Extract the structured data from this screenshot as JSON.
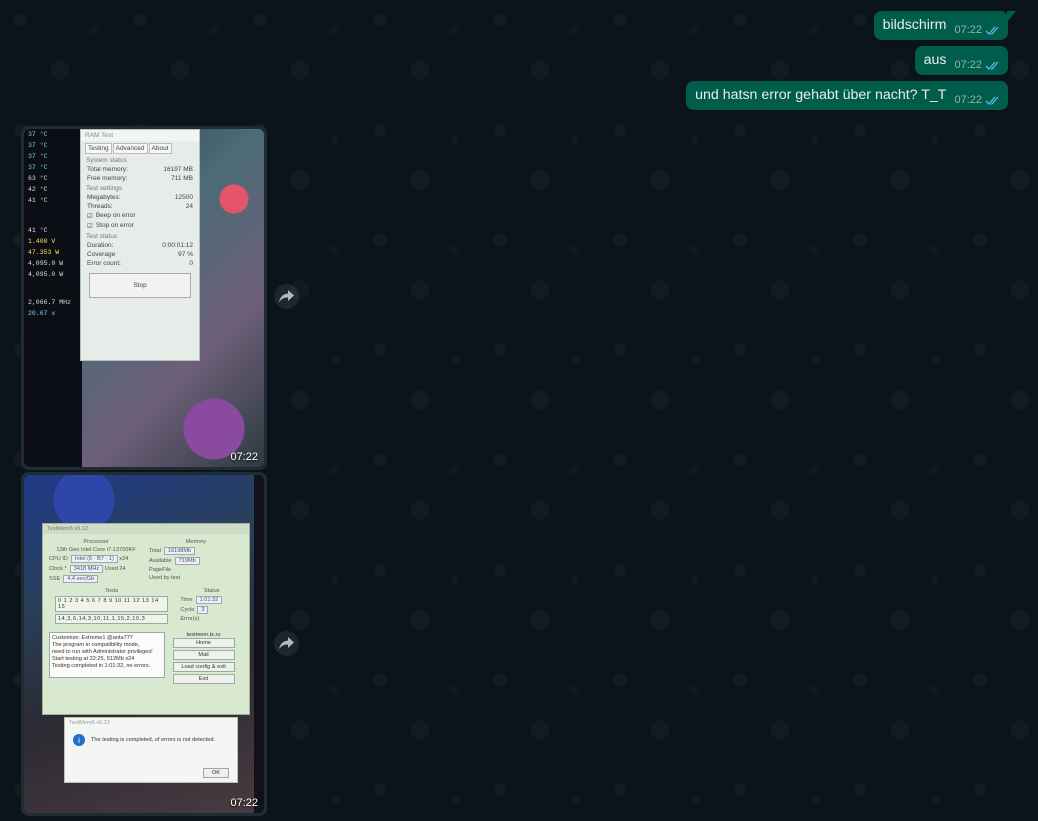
{
  "messages": [
    {
      "text": "bildschirm",
      "time": "07:22"
    },
    {
      "text": "aus",
      "time": "07:22"
    },
    {
      "text": "und hatsn error gehabt über nacht? T_T",
      "time": "07:22"
    }
  ],
  "images": [
    {
      "time": "07:22"
    },
    {
      "time": "07:22"
    }
  ],
  "photo1": {
    "temps": [
      "37 °C",
      "37 °C",
      "37 °C",
      "37 °C",
      "63 °C",
      "42 °C",
      "41 °C"
    ],
    "mid": [
      "41 °C",
      "1.400 V",
      "47.353 W",
      "4,095.0 W",
      "4,095.0 W"
    ],
    "clock": [
      "2,066.7 MHz",
      "20.67 x"
    ],
    "ram_title": "RAM Test",
    "tabs": [
      "Testing",
      "Advanced",
      "About"
    ],
    "system_status": "System status",
    "total_memory_label": "Total memory:",
    "total_memory": "16197 MB",
    "free_memory_label": "Free memory:",
    "free_memory": "711 MB",
    "test_settings": "Test settings",
    "megabytes_label": "Megabytes:",
    "megabytes": "12500",
    "threads_label": "Threads:",
    "threads": "24",
    "beep": "Beep on error",
    "stop_on_error": "Stop on error",
    "test_status": "Test status",
    "duration_label": "Duration:",
    "duration": "0:00:01:12",
    "coverage_label": "Coverage",
    "coverage": "97 %",
    "errors_label": "Error count:",
    "errors": "0",
    "stop": "Stop"
  },
  "photo2": {
    "title": "TestMem5 v0.12",
    "processor": "Processor",
    "cpu": "13th Gen Intel Core i7-13700KF",
    "cpuid_label": "CPU ID",
    "cpuid": "Intel (6 · B7 · 1)",
    "threads": "x24",
    "clock_label": "Clock *",
    "clock": "3418 MHz",
    "used_label": "Used",
    "used": "24",
    "sse_label": "SSE",
    "sse": "4,4 sec/Gb",
    "memory": "Memory",
    "total_label": "Total",
    "total": "16198Mb",
    "available_label": "Available",
    "available": "719Mb",
    "pagefile_label": "PageFile",
    "used_by_test_label": "Used by test",
    "tests": "Tests",
    "test_numbers": "0 1 2 3 4 5 6 7 8 9 10 11 12 13 14 15",
    "test_seq": "14,3,6,14,3,10,11,1,15,2,10,3",
    "status": "Status",
    "time_label": "Time",
    "time": "1:01:32",
    "cycle_label": "Cycle",
    "cycle": "3",
    "errors_label": "Error(s)",
    "log": [
      "Customize: Extreme1 @anta777",
      "The program in compatibility mode,",
      "need to run with Administrator privileges!",
      "Start testing at 22:25, 512Mb x24",
      "Testing completed in 1:01:32, no errors."
    ],
    "site": "testmem.tz.ru",
    "buttons": [
      "Home",
      "Mail",
      "Load config & exit",
      "Exit"
    ],
    "dialog_title": "TestMem5 v0.12",
    "dialog_message": "The testing is completed, of errors is not detected.",
    "ok": "OK"
  },
  "colors": {
    "background": "#0b141a",
    "outgoing_bubble": "#005c4b",
    "incoming_bubble": "#202c33",
    "read_ticks": "#53bdeb"
  }
}
